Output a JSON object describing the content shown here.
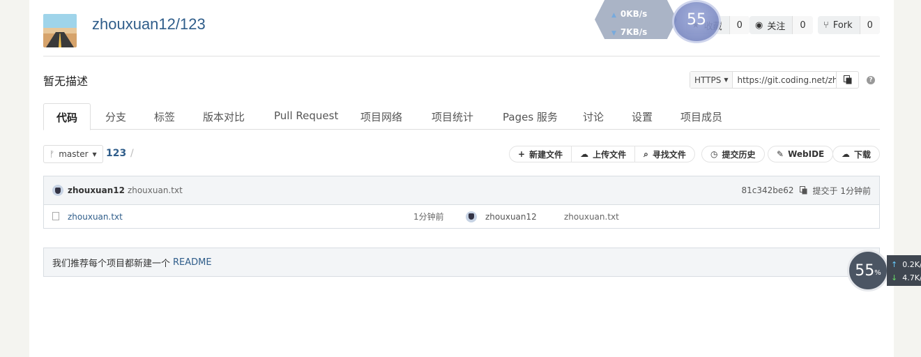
{
  "header": {
    "repo_title": "zhouxuan12/123",
    "star": {
      "label": "收藏",
      "count": "0"
    },
    "watch": {
      "label": "关注",
      "count": "0"
    },
    "fork": {
      "label": "Fork",
      "count": "0"
    }
  },
  "description": "暂无描述",
  "clone": {
    "protocol": "HTTPS",
    "url": "https://git.coding.net/zh"
  },
  "tabs": [
    {
      "label": "代码",
      "active": true
    },
    {
      "label": "分支"
    },
    {
      "label": "标签"
    },
    {
      "label": "版本对比"
    },
    {
      "label": "Pull Request"
    },
    {
      "label": "项目网络"
    },
    {
      "label": "项目统计"
    },
    {
      "label": "Pages 服务"
    },
    {
      "label": "讨论"
    },
    {
      "label": "设置"
    },
    {
      "label": "项目成员"
    }
  ],
  "branch": {
    "name": "master",
    "path_root": "123",
    "separator": "/"
  },
  "actions": {
    "new_file": "新建文件",
    "upload_file": "上传文件",
    "find_file": "寻找文件",
    "history": "提交历史",
    "webide": "WebIDE",
    "download": "下载"
  },
  "latest_commit": {
    "user": "zhouxuan12",
    "message": "zhouxuan.txt",
    "hash": "81c342be62",
    "time": "提交于 1分钟前"
  },
  "files": [
    {
      "name": "zhouxuan.txt",
      "time": "1分钟前",
      "user": "zhouxuan12",
      "message": "zhouxuan.txt"
    }
  ],
  "readme": {
    "text": "我们推荐每个项目都新建一个",
    "link": "README"
  },
  "overlay": {
    "top_up": "0KB/s",
    "top_down": "7KB/s",
    "top_gauge": "55",
    "bottom_gauge": "55",
    "bottom_gauge_unit": "%",
    "side_up": "0.2K/",
    "side_down": "4.7K/"
  }
}
